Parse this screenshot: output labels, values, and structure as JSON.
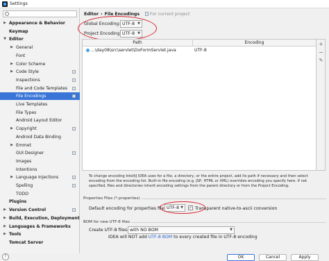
{
  "window": {
    "title": "Settings"
  },
  "sidebar": {
    "items": [
      {
        "label": "Appearance & Behavior",
        "bold": true,
        "arrow": "▶",
        "depth": 0,
        "proj": false
      },
      {
        "label": "Keymap",
        "bold": true,
        "arrow": "",
        "depth": 0,
        "proj": false
      },
      {
        "label": "Editor",
        "bold": true,
        "arrow": "▼",
        "depth": 0,
        "proj": false
      },
      {
        "label": "General",
        "bold": false,
        "arrow": "▶",
        "depth": 1,
        "proj": false
      },
      {
        "label": "Font",
        "bold": false,
        "arrow": "",
        "depth": 1,
        "proj": false
      },
      {
        "label": "Color Scheme",
        "bold": false,
        "arrow": "▶",
        "depth": 1,
        "proj": false
      },
      {
        "label": "Code Style",
        "bold": false,
        "arrow": "▶",
        "depth": 1,
        "proj": true
      },
      {
        "label": "Inspections",
        "bold": false,
        "arrow": "",
        "depth": 1,
        "proj": true
      },
      {
        "label": "File and Code Templates",
        "bold": false,
        "arrow": "",
        "depth": 1,
        "proj": true
      },
      {
        "label": "File Encodings",
        "bold": false,
        "arrow": "",
        "depth": 1,
        "proj": true,
        "selected": true
      },
      {
        "label": "Live Templates",
        "bold": false,
        "arrow": "",
        "depth": 1,
        "proj": false
      },
      {
        "label": "File Types",
        "bold": false,
        "arrow": "",
        "depth": 1,
        "proj": false
      },
      {
        "label": "Android Layout Editor",
        "bold": false,
        "arrow": "",
        "depth": 1,
        "proj": false
      },
      {
        "label": "Copyright",
        "bold": false,
        "arrow": "▶",
        "depth": 1,
        "proj": true
      },
      {
        "label": "Android Data Binding",
        "bold": false,
        "arrow": "",
        "depth": 1,
        "proj": false
      },
      {
        "label": "Emmet",
        "bold": false,
        "arrow": "▶",
        "depth": 1,
        "proj": false
      },
      {
        "label": "GUI Designer",
        "bold": false,
        "arrow": "",
        "depth": 1,
        "proj": true
      },
      {
        "label": "Images",
        "bold": false,
        "arrow": "",
        "depth": 1,
        "proj": false
      },
      {
        "label": "Intentions",
        "bold": false,
        "arrow": "",
        "depth": 1,
        "proj": false
      },
      {
        "label": "Language Injections",
        "bold": false,
        "arrow": "▶",
        "depth": 1,
        "proj": true
      },
      {
        "label": "Spelling",
        "bold": false,
        "arrow": "",
        "depth": 1,
        "proj": true
      },
      {
        "label": "TODO",
        "bold": false,
        "arrow": "",
        "depth": 1,
        "proj": false
      },
      {
        "label": "Plugins",
        "bold": true,
        "arrow": "",
        "depth": 0,
        "proj": false
      },
      {
        "label": "Version Control",
        "bold": true,
        "arrow": "▶",
        "depth": 0,
        "proj": true
      },
      {
        "label": "Build, Execution, Deployment",
        "bold": true,
        "arrow": "▶",
        "depth": 0,
        "proj": false
      },
      {
        "label": "Languages & Frameworks",
        "bold": true,
        "arrow": "▶",
        "depth": 0,
        "proj": false
      },
      {
        "label": "Tools",
        "bold": true,
        "arrow": "▶",
        "depth": 0,
        "proj": false
      },
      {
        "label": "Tomcat Server",
        "bold": true,
        "arrow": "",
        "depth": 0,
        "proj": false
      }
    ]
  },
  "header": {
    "crumb_parent": "Editor",
    "crumb_separator": "›",
    "crumb_current": "File Encodings",
    "scope_note": "For current project"
  },
  "encodings": {
    "global_label": "Global Encoding:",
    "global_value": "UTF-8",
    "project_label": "Project Encoding:",
    "project_value": "UTF-8"
  },
  "table": {
    "columns": [
      "Path",
      "Encoding"
    ],
    "rows": [
      {
        "path": "...\\day08\\src\\servlet\\DoFormServlet.java",
        "encoding": "UTF-8"
      }
    ]
  },
  "tools": {
    "add": "+",
    "remove": "−",
    "edit": "✎"
  },
  "description": "To change encoding IntelliJ IDEA uses for a file, a directory, or the entire project, add its path if necessary and then select encoding from the encoding list. Built-in file encoding (e.g. JSP, HTML or XML) overrides encoding you specify here. If not specified, files and directories inherit encoding settings from the parent directory or from the Project Encoding.",
  "properties": {
    "group_title": "Properties Files (*.properties)",
    "default_label": "Default encoding for properties files:",
    "default_value": "UTF-8",
    "transparent_label": "Transparent native-to-ascii conversion",
    "transparent_checked": true,
    "check_glyph": "✓"
  },
  "bom": {
    "group_title": "BOM for new UTF-8 files",
    "create_label": "Create UTF-8 files:",
    "create_value": "with NO BOM",
    "note_prefix": "IDEA will NOT add ",
    "note_link": "UTF-8 BOM",
    "note_suffix": " to every created file in UTF-8 encoding"
  },
  "buttons": {
    "help": "?",
    "ok": "OK",
    "cancel": "Cancel",
    "apply": "Apply"
  },
  "accent": "#3875d7",
  "annotation_color": "#d9202a"
}
